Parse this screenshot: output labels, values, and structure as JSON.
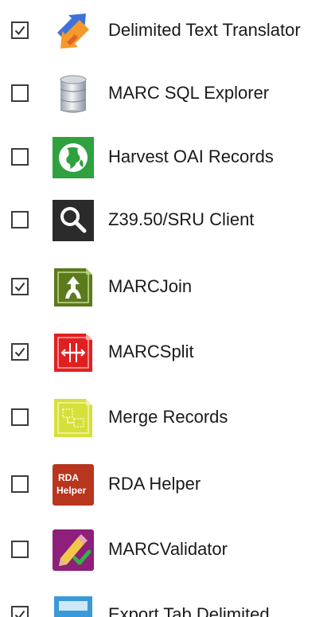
{
  "tools": [
    {
      "label": "Delimited Text Translator",
      "checked": true,
      "icon": "delimited-text-translator-icon"
    },
    {
      "label": "MARC SQL Explorer",
      "checked": false,
      "icon": "database-icon"
    },
    {
      "label": "Harvest OAI Records",
      "checked": false,
      "icon": "globe-icon"
    },
    {
      "label": "Z39.50/SRU Client",
      "checked": false,
      "icon": "magnifier-icon"
    },
    {
      "label": "MARCJoin",
      "checked": true,
      "icon": "marcjoin-icon"
    },
    {
      "label": "MARCSplit",
      "checked": true,
      "icon": "marcsplit-icon"
    },
    {
      "label": "Merge Records",
      "checked": false,
      "icon": "merge-records-icon"
    },
    {
      "label": "RDA Helper",
      "checked": false,
      "icon": "rda-helper-icon",
      "icon_text": [
        "RDA",
        "Helper"
      ]
    },
    {
      "label": "MARCValidator",
      "checked": false,
      "icon": "marcvalidator-icon"
    },
    {
      "label": "Export Tab Delimited",
      "checked": true,
      "icon": "export-tab-delimited-icon"
    }
  ]
}
